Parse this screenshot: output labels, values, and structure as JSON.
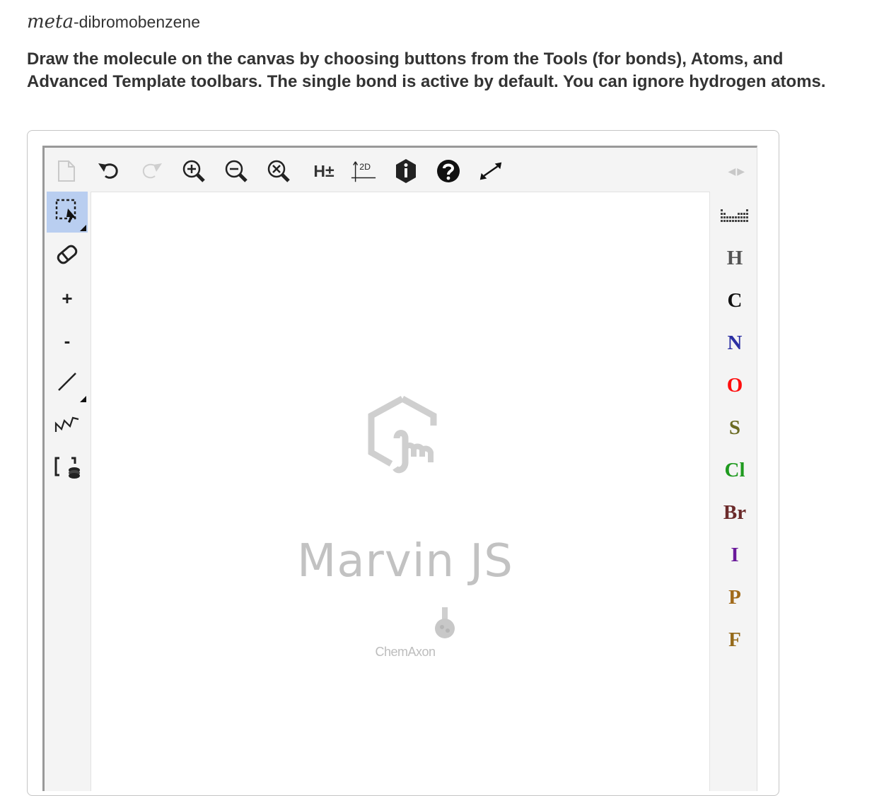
{
  "title": {
    "italic_prefix": "meta",
    "rest": "-dibromobenzene"
  },
  "instructions": "Draw the molecule on the canvas by choosing buttons from the Tools (for bonds), Atoms, and Advanced Template toolbars. The single bond is active by default. You can ignore hydrogen atoms.",
  "top_toolbar": {
    "icons": [
      "new-document-icon",
      "undo-icon",
      "redo-icon",
      "zoom-in-icon",
      "zoom-out-icon",
      "zoom-reset-icon",
      "hydrogen-toggle-icon",
      "clean-2d-icon",
      "info-icon",
      "help-icon",
      "fullscreen-icon"
    ],
    "hydrogen_label": "H±",
    "clean2d_label": "2D",
    "nav_arrows": "◀▶"
  },
  "left_toolbar": {
    "icons": [
      "selection-icon",
      "eraser-icon",
      "increase-charge-icon",
      "decrease-charge-icon",
      "single-bond-icon",
      "chain-icon",
      "bracket-icon"
    ],
    "plus_label": "+",
    "minus_label": "-",
    "active": "selection"
  },
  "canvas": {
    "brand_name": "Marvin JS",
    "company": "ChemAxon"
  },
  "atoms_toolbar": {
    "periodic_table_icon": "periodic-table-icon",
    "atoms": [
      {
        "symbol": "H",
        "color": "#555555"
      },
      {
        "symbol": "C",
        "color": "#111111"
      },
      {
        "symbol": "N",
        "color": "#2b2fa3"
      },
      {
        "symbol": "O",
        "color": "#ff0d0d"
      },
      {
        "symbol": "S",
        "color": "#6b6b23"
      },
      {
        "symbol": "Cl",
        "color": "#1f9a1f"
      },
      {
        "symbol": "Br",
        "color": "#6b2a2a"
      },
      {
        "symbol": "I",
        "color": "#6a1a9a"
      },
      {
        "symbol": "P",
        "color": "#a16a1a"
      },
      {
        "symbol": "F",
        "color": "#956a1a"
      }
    ]
  }
}
